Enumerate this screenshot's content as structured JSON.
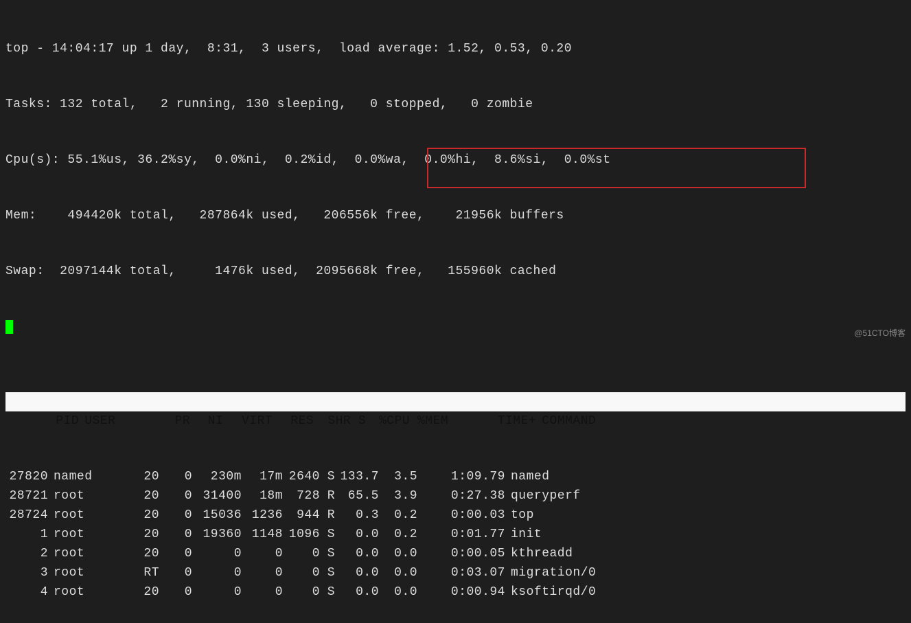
{
  "summary": {
    "line1": "top - 14:04:17 up 1 day,  8:31,  3 users,  load average: 1.52, 0.53, 0.20",
    "line2": "Tasks: 132 total,   2 running, 130 sleeping,   0 stopped,   0 zombie",
    "line3": "Cpu(s): 55.1%us, 36.2%sy,  0.0%ni,  0.2%id,  0.0%wa,  0.0%hi,  8.6%si,  0.0%st",
    "line4": "Mem:    494420k total,   287864k used,   206556k free,    21956k buffers",
    "line5": "Swap:  2097144k total,     1476k used,  2095668k free,   155960k cached"
  },
  "headers": {
    "pid": "PID",
    "user": "USER",
    "pr": "PR",
    "ni": "NI",
    "virt": "VIRT",
    "res": "RES",
    "shr": "SHR",
    "s": "S",
    "cpu": "%CPU",
    "mem": "%MEM",
    "time": "TIME+",
    "cmd": "COMMAND"
  },
  "processes": [
    {
      "pid": "27820",
      "user": "named",
      "pr": "20",
      "ni": "0",
      "virt": "230m",
      "res": "17m",
      "shr": "2640",
      "s": "S",
      "cpu": "133.7",
      "mem": "3.5",
      "time": "1:09.79",
      "cmd": "named"
    },
    {
      "pid": "28721",
      "user": "root",
      "pr": "20",
      "ni": "0",
      "virt": "31400",
      "res": "18m",
      "shr": "728",
      "s": "R",
      "cpu": "65.5",
      "mem": "3.9",
      "time": "0:27.38",
      "cmd": "queryperf"
    },
    {
      "pid": "28724",
      "user": "root",
      "pr": "20",
      "ni": "0",
      "virt": "15036",
      "res": "1236",
      "shr": "944",
      "s": "R",
      "cpu": "0.3",
      "mem": "0.2",
      "time": "0:00.03",
      "cmd": "top"
    },
    {
      "pid": "1",
      "user": "root",
      "pr": "20",
      "ni": "0",
      "virt": "19360",
      "res": "1148",
      "shr": "1096",
      "s": "S",
      "cpu": "0.0",
      "mem": "0.2",
      "time": "0:01.77",
      "cmd": "init"
    },
    {
      "pid": "2",
      "user": "root",
      "pr": "20",
      "ni": "0",
      "virt": "0",
      "res": "0",
      "shr": "0",
      "s": "S",
      "cpu": "0.0",
      "mem": "0.0",
      "time": "0:00.05",
      "cmd": "kthreadd"
    },
    {
      "pid": "3",
      "user": "root",
      "pr": "RT",
      "ni": "0",
      "virt": "0",
      "res": "0",
      "shr": "0",
      "s": "S",
      "cpu": "0.0",
      "mem": "0.0",
      "time": "0:03.07",
      "cmd": "migration/0"
    },
    {
      "pid": "4",
      "user": "root",
      "pr": "20",
      "ni": "0",
      "virt": "0",
      "res": "0",
      "shr": "0",
      "s": "S",
      "cpu": "0.0",
      "mem": "0.0",
      "time": "0:00.94",
      "cmd": "ksoftirqd/0"
    }
  ],
  "watermark": "@51CTO博客"
}
